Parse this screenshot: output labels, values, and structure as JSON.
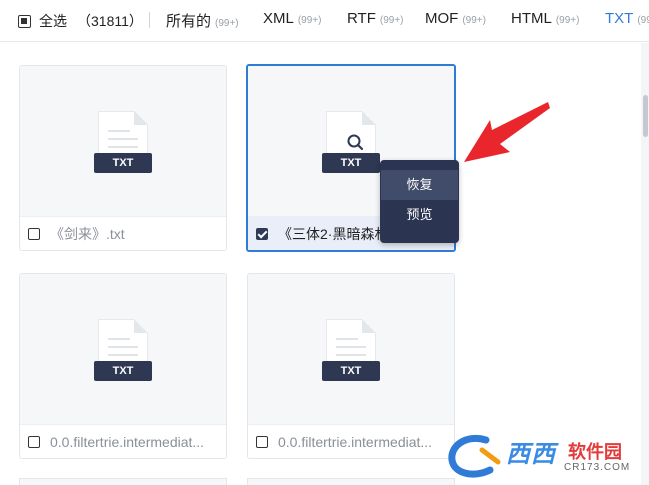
{
  "filter_bar": {
    "select_all_label": "全选",
    "total_count": "（31811）",
    "types": [
      {
        "label": "所有的",
        "count": "(99+)"
      },
      {
        "label": "XML",
        "count": "(99+)"
      },
      {
        "label": "RTF",
        "count": "(99+)"
      },
      {
        "label": "MOF",
        "count": "(99+)"
      },
      {
        "label": "HTML",
        "count": "(99+)"
      },
      {
        "label": "TXT",
        "count": "(99"
      }
    ]
  },
  "files": [
    {
      "name": "《剑来》.txt",
      "badge": "TXT",
      "checked": false
    },
    {
      "name": "《三体2·黑暗森林",
      "badge": "TXT",
      "checked": true
    },
    {
      "name": "0.0.filtertrie.intermediat...",
      "badge": "TXT",
      "checked": false
    },
    {
      "name": "0.0.filtertrie.intermediat...",
      "badge": "TXT",
      "checked": false
    }
  ],
  "context_menu": {
    "items": [
      "恢复",
      "预览"
    ]
  },
  "watermark": {
    "brand": "西西",
    "brand2": "软件园",
    "site": "CR173.COM"
  },
  "colors": {
    "accent": "#2f7bd6",
    "badge": "#2e3853",
    "menu": "#2b3552",
    "arrow": "#e8262b"
  }
}
